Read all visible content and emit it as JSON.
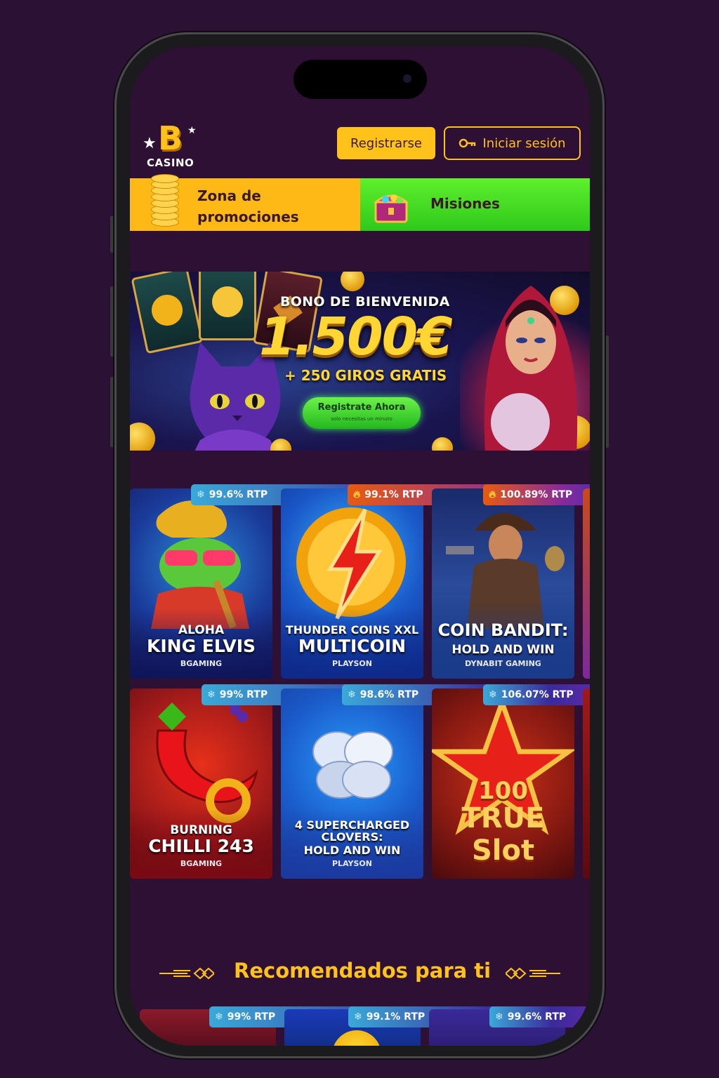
{
  "header": {
    "logo_letter": "B",
    "logo_text": "CASINO",
    "register_label": "Registrarse",
    "login_label": "Iniciar sesión"
  },
  "promo_bar": {
    "promotions_label": "Zona de promociones",
    "missions_label": "Misiones"
  },
  "banner": {
    "title": "BONO DE BIENVENIDA",
    "amount": "1.500€",
    "extra": "+ 250 GIROS GRATIS",
    "cta_label": "Registrate Ahora",
    "cta_sublabel": "solo necesitas un minuto"
  },
  "games": [
    {
      "line1": "ALOHA",
      "line2": "KING ELVIS",
      "provider": "BGAMING",
      "rtp": "99.6% RTP",
      "rtp_kind": "cold"
    },
    {
      "line1": "THUNDER COINS XXL",
      "line2": "MULTICOIN",
      "provider": "PLAYSON",
      "rtp": "99.1% RTP",
      "rtp_kind": "hot"
    },
    {
      "line1": "COIN BANDIT:",
      "line2": "HOLD AND WIN",
      "provider": "DYNABIT GAMING",
      "rtp": "100.89% RTP",
      "rtp_kind": "hot"
    },
    {
      "line1": "BURNING",
      "line2": "CHILLI 243",
      "provider": "BGAMING",
      "rtp": "99% RTP",
      "rtp_kind": "cold"
    },
    {
      "line1": "4 SUPERCHARGED CLOVERS:",
      "line2": "HOLD AND WIN",
      "provider": "PLAYSON",
      "rtp": "98.6% RTP",
      "rtp_kind": "cold"
    },
    {
      "line1": "100",
      "line2": "TRUE Slot",
      "provider": "",
      "rtp": "106.07% RTP",
      "rtp_kind": "cold"
    }
  ],
  "recommended": {
    "title": "Recomendados para ti",
    "rtps": [
      "99% RTP",
      "99.1% RTP",
      "99.6% RTP"
    ]
  },
  "colors": {
    "background": "#2b1234",
    "screen": "#2f1035",
    "accent_yellow": "#ffc21a",
    "missions_green": "#3fd421"
  }
}
